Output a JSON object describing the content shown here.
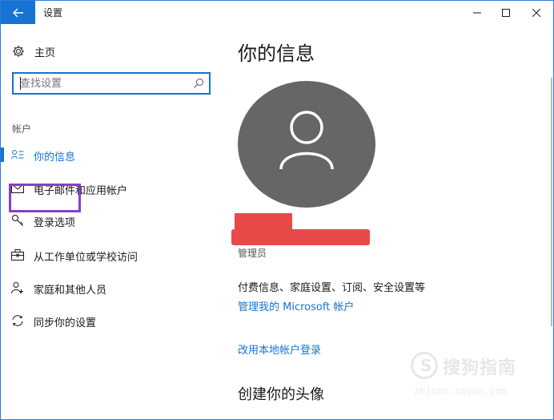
{
  "window": {
    "title": "设置",
    "icons": {
      "back": "back-arrow-icon",
      "minimize": "minimize-icon",
      "maximize": "maximize-icon",
      "close": "close-icon"
    },
    "accent": "#1673d3"
  },
  "sidebar": {
    "home_label": "主页",
    "search_placeholder": "查找设置",
    "section_title": "帐户",
    "items": [
      {
        "label": "你的信息",
        "icon": "person-list-icon",
        "active": true
      },
      {
        "label": "电子邮件和应用帐户",
        "icon": "mail-icon",
        "active": false
      },
      {
        "label": "登录选项",
        "icon": "key-icon",
        "active": false
      },
      {
        "label": "从工作单位或学校访问",
        "icon": "briefcase-icon",
        "active": false
      },
      {
        "label": "家庭和其他人员",
        "icon": "add-person-icon",
        "active": false
      },
      {
        "label": "同步你的设置",
        "icon": "sync-icon",
        "active": false
      }
    ],
    "highlight_color": "#8a3fc7"
  },
  "main": {
    "title": "你的信息",
    "avatar_icon": "user-avatar-icon",
    "role": "管理员",
    "billing_text": "付费信息、家庭设置、订阅、安全设置等",
    "link_ms_account": "管理我的 Microsoft 帐户",
    "link_local": "改用本地帐户登录",
    "subtitle": "创建你的头像",
    "redaction_color": "#e84a4a"
  },
  "watermark": {
    "text": "搜狗指南",
    "url": "zhinan.sogou.com"
  }
}
